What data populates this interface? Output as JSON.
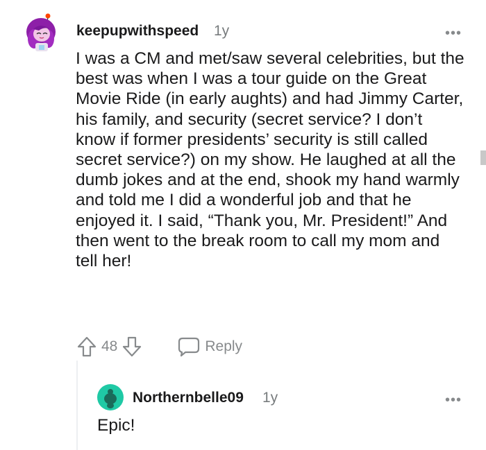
{
  "comment": {
    "username": "keepupwithspeed",
    "age": "1y",
    "more_label": "•••",
    "text": "I was a CM and met/saw several celebrities, but the best was when I was a tour guide on the Great Movie Ride (in early aughts) and had Jimmy Carter, his family, and security (secret service? I don’t know if former presidents’ security is still called secret service?) on my show. He laughed at all the dumb jokes and at the end, shook my hand warmly and told me I did a wonderful job and that he enjoyed it. I said, “Thank you, Mr. President!” And then went to the break room to call my mom and tell her!",
    "score": "48",
    "reply_label": "Reply",
    "avatar_icon": "avatar-purple-hair-icon"
  },
  "reply": {
    "username": "Northernbelle09",
    "age": "1y",
    "more_label": "•••",
    "text": "Epic!",
    "avatar_icon": "snoo-avatar-icon"
  },
  "colors": {
    "text": "#1a1a1b",
    "muted": "#878a8c",
    "avatar_purple": "#8a2be2",
    "avatar_green": "#1fc9a5"
  }
}
